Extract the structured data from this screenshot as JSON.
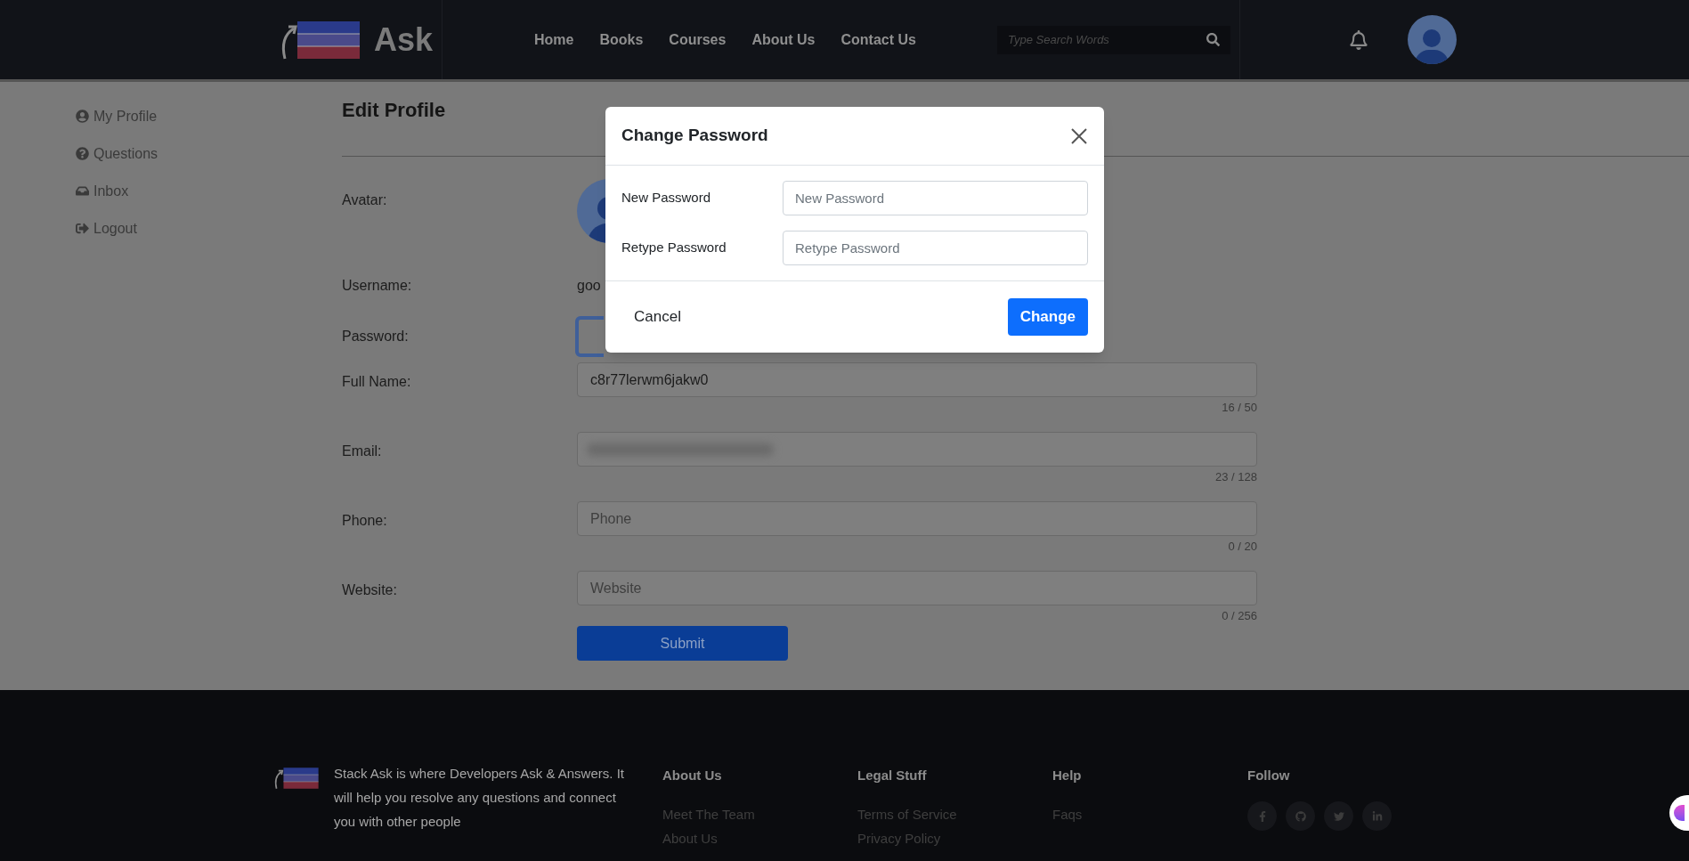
{
  "header": {
    "logo_text": "Ask",
    "nav": [
      {
        "label": "Home"
      },
      {
        "label": "Books"
      },
      {
        "label": "Courses"
      },
      {
        "label": "About Us"
      },
      {
        "label": "Contact Us"
      }
    ],
    "search": {
      "placeholder": "Type Search Words"
    }
  },
  "sidebar": {
    "items": [
      {
        "label": "My Profile",
        "kind": "profile"
      },
      {
        "label": "Questions",
        "kind": "question"
      },
      {
        "label": "Inbox",
        "kind": "inbox"
      },
      {
        "label": "Logout",
        "kind": "logout"
      }
    ]
  },
  "form": {
    "title": "Edit Profile",
    "rows": [
      {
        "label": "Avatar:",
        "kind": "avatar"
      },
      {
        "label": "Username:",
        "kind": "text",
        "value": "goo"
      },
      {
        "label": "Password:",
        "kind": "button"
      },
      {
        "label": "Full Name:",
        "kind": "input",
        "value": "c8r77lerwm6jakw0",
        "counter": "16 / 50"
      },
      {
        "label": "Email:",
        "kind": "blurred",
        "counter": "23 / 128"
      },
      {
        "label": "Phone:",
        "kind": "input",
        "placeholder": "Phone",
        "counter": "0 / 20"
      },
      {
        "label": "Website:",
        "kind": "input",
        "placeholder": "Website",
        "counter": "0 / 256"
      }
    ],
    "submit": "Submit"
  },
  "modal": {
    "title": "Change Password",
    "fields": [
      {
        "label": "New Password",
        "placeholder": "New Password"
      },
      {
        "label": "Retype Password",
        "placeholder": "Retype Password"
      }
    ],
    "cancel": "Cancel",
    "confirm": "Change"
  },
  "footer": {
    "about": "Stack Ask is where Developers Ask & Answers. It will help you resolve any questions and connect you with other people",
    "columns": [
      {
        "title": "About Us",
        "links": [
          "Meet The Team",
          "About Us"
        ]
      },
      {
        "title": "Legal Stuff",
        "links": [
          "Terms of Service",
          "Privacy Policy"
        ]
      },
      {
        "title": "Help",
        "links": [
          "Faqs"
        ]
      }
    ],
    "follow": {
      "title": "Follow",
      "icons": [
        {
          "kind": "facebook"
        },
        {
          "kind": "github"
        },
        {
          "kind": "twitter"
        },
        {
          "kind": "linkedin"
        }
      ]
    }
  }
}
